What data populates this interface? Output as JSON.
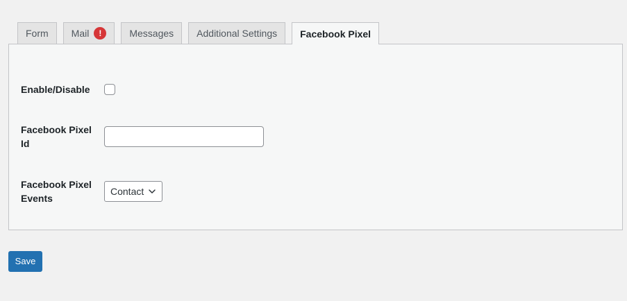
{
  "tabs": [
    {
      "label": "Form",
      "active": false
    },
    {
      "label": "Mail",
      "active": false,
      "warning_icon": "exclamation-icon",
      "warning_text": "!"
    },
    {
      "label": "Messages",
      "active": false
    },
    {
      "label": "Additional Settings",
      "active": false
    },
    {
      "label": "Facebook Pixel",
      "active": true
    }
  ],
  "form": {
    "enable_label": "Enable/Disable",
    "enable_checked": false,
    "pixel_id_label": "Facebook Pixel Id",
    "pixel_id_value": "",
    "events_label": "Facebook Pixel Events",
    "events_selected": "Contact"
  },
  "actions": {
    "save_label": "Save"
  },
  "colors": {
    "primary": "#2271b1",
    "warning": "#d63638",
    "background": "#f1f1f1",
    "panel": "#f6f7f7",
    "border": "#c3c4c7"
  }
}
